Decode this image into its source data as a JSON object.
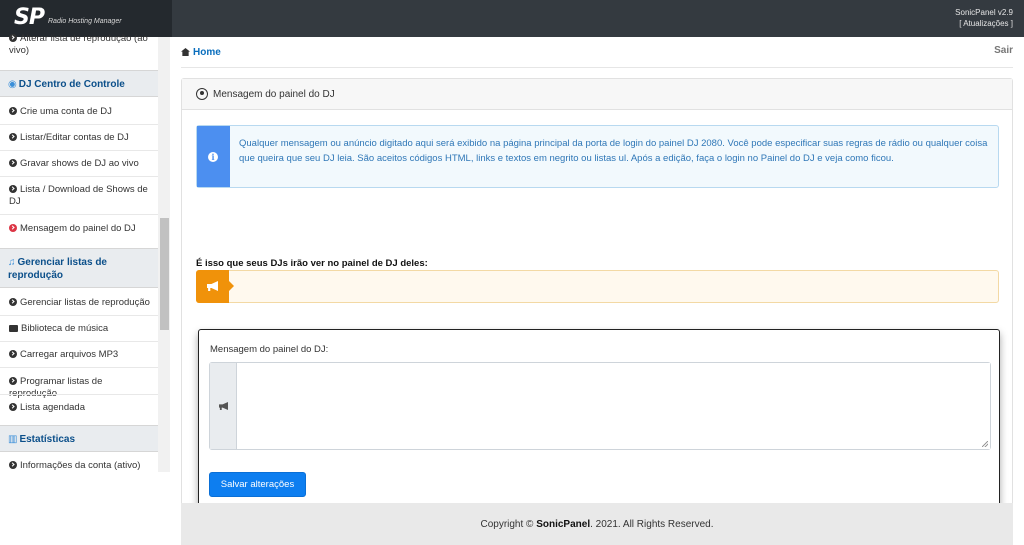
{
  "header": {
    "logo_mark": "SP",
    "logo_tagline": "Radio Hosting Manager",
    "version": "SonicPanel v2.9",
    "updates_link": "[ Atualizações ]"
  },
  "sidebar": {
    "top_item": "Alterar lista de reprodução (ao vivo)",
    "sections": [
      {
        "title": "DJ Centro de Controle",
        "icon": "user-circle-icon",
        "items": [
          "Crie uma conta de DJ",
          "Listar/Editar contas de DJ",
          "Gravar shows de DJ ao vivo",
          "Lista / Download de Shows de DJ",
          "Mensagem do painel do DJ"
        ]
      },
      {
        "title": "Gerenciar listas de reprodução",
        "icon": "music-note-icon",
        "items": [
          "Gerenciar listas de reprodução",
          "Biblioteca de música",
          "Carregar arquivos MP3",
          "Programar listas de reprodução",
          "Lista agendada"
        ]
      },
      {
        "title": "Estatísticas",
        "icon": "bar-chart-icon",
        "items": [
          "Informações da conta (ativo)"
        ]
      }
    ],
    "active_item_color": "#dc3545"
  },
  "breadcrumb": {
    "home": "Home",
    "logout": "Sair"
  },
  "card": {
    "title": "Mensagem do painel do DJ",
    "info_text": "Qualquer mensagem ou anúncio digitado aqui será exibido na página principal da porta de login do painel DJ 2080. Você pode especificar suas regras de rádio ou qualquer coisa que queira que seu DJ leia. São aceitos códigos HTML, links e textos em negrito ou listas ul. Após a edição, faça o login no Painel do DJ e veja como ficou.",
    "preview_label": "É isso que seus DJs irão ver no painel de DJ deles:",
    "editor_label": "Mensagem do painel do DJ:",
    "textarea_value": "",
    "save_label": "Salvar alterações"
  },
  "footer": {
    "prefix": "Copyright ©",
    "brand": "SonicPanel",
    "suffix": ". 2021. All Rights Reserved."
  },
  "colors": {
    "topbar": "#343a40",
    "info_accent": "#4c8ff0",
    "preview_accent": "#f0920a",
    "primary_button": "#0d7ef0"
  }
}
